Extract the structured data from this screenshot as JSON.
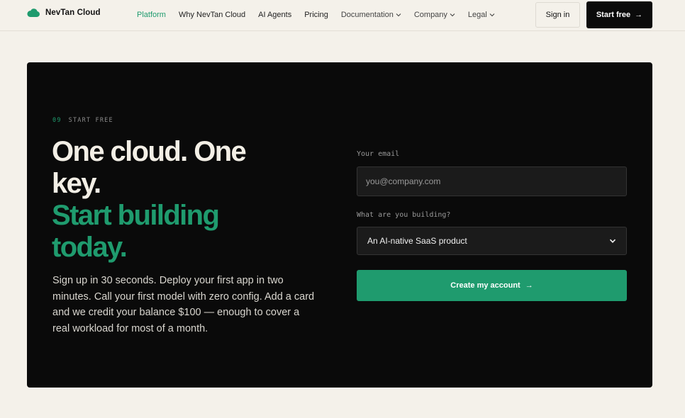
{
  "brand": {
    "name": "NevTan Cloud",
    "accent": "#1f9b6e"
  },
  "nav": {
    "items": [
      {
        "label": "Platform",
        "active": true
      },
      {
        "label": "Why NevTan Cloud"
      },
      {
        "label": "AI Agents"
      },
      {
        "label": "Pricing"
      },
      {
        "label": "Documentation",
        "dropdown": true
      },
      {
        "label": "Company",
        "dropdown": true
      },
      {
        "label": "Legal",
        "dropdown": true
      }
    ],
    "signin_label": "Sign in",
    "start_label": "Start free",
    "start_arrow": "→"
  },
  "hero": {
    "eyebrow_num": "09",
    "eyebrow_text": "START FREE",
    "headline_line1": "One cloud. One",
    "headline_line2": "key.",
    "headline_green1": "Start building",
    "headline_green2": "today.",
    "lede": "Sign up in 30 seconds. Deploy your first app in two minutes. Call your first model with zero config. Add a card and we credit your balance $100 — enough to cover a real workload for most of a month."
  },
  "form": {
    "email_label": "Your email",
    "email_placeholder": "you@company.com",
    "email_value": "",
    "building_label": "What are you building?",
    "building_selected": "An AI-native SaaS product",
    "submit_label": "Create my account",
    "submit_arrow": "→"
  }
}
